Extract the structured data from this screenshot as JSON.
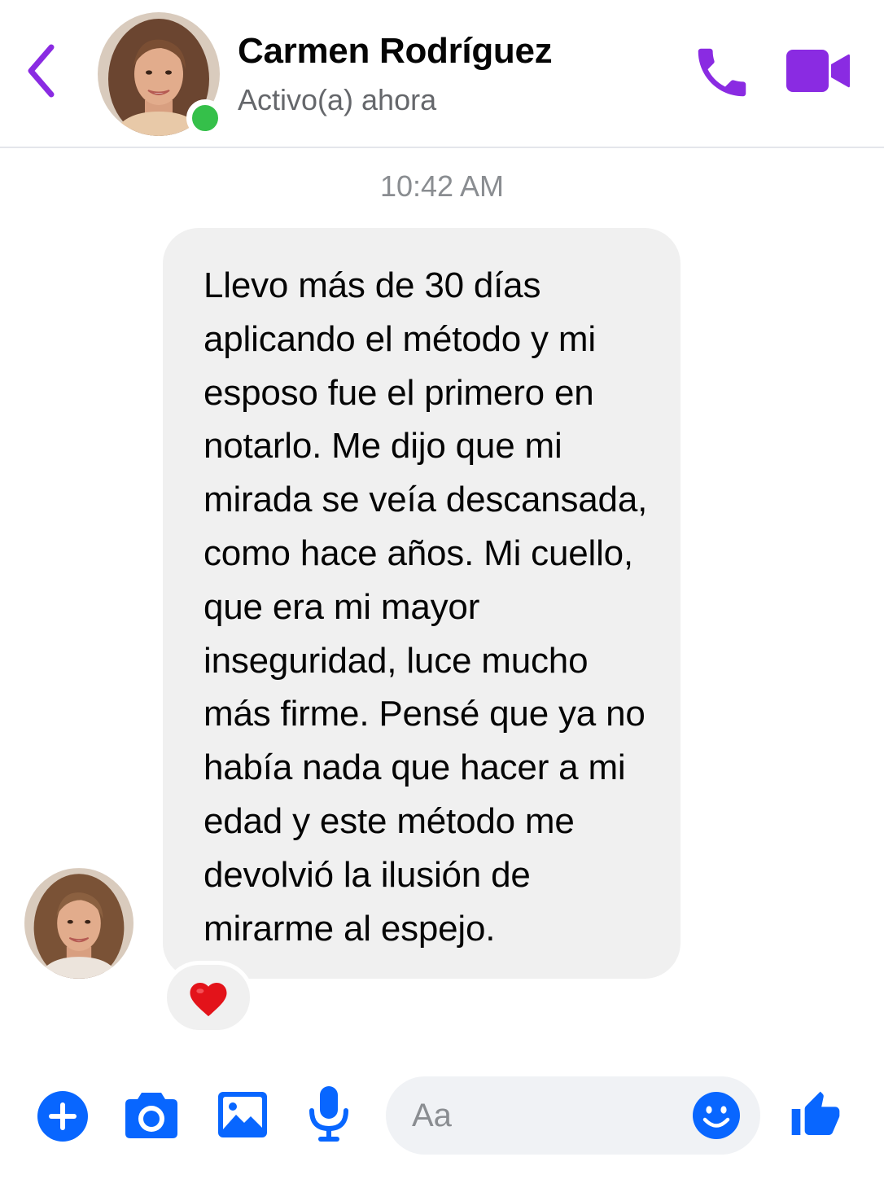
{
  "header": {
    "contact_name": "Carmen Rodríguez",
    "status": "Activo(a) ahora",
    "online": true
  },
  "conversation": {
    "timestamp": "10:42 AM",
    "messages": [
      {
        "text": "Llevo más de 30 días\naplicando el método y mi\nesposo fue el primero en\nnotarlo. Me dijo que mi\nmirada se veía descansada,\ncomo hace años. Mi cuello,\nque era mi mayor\ninseguridad, luce mucho\nmás firme. Pensé que ya no\nhabía nada que hacer a mi\nedad y este método me\ndevolvió la ilusión de\nmirarme al espejo.",
        "reaction": "❤️"
      }
    ]
  },
  "composer": {
    "placeholder": "Aa"
  },
  "colors": {
    "accent": "#8a2be2",
    "composer_icons": "#0866ff",
    "online": "#35c04a",
    "bubble_bg": "#f0f0f0",
    "heart": "#e3131a"
  },
  "icons": {
    "back": "chevron-left-icon",
    "call": "phone-icon",
    "video": "video-camera-icon",
    "plus": "plus-circle-icon",
    "camera": "camera-icon",
    "gallery": "image-icon",
    "mic": "microphone-icon",
    "emoji": "smiley-icon",
    "like": "thumbs-up-icon",
    "reaction": "heart-icon"
  }
}
